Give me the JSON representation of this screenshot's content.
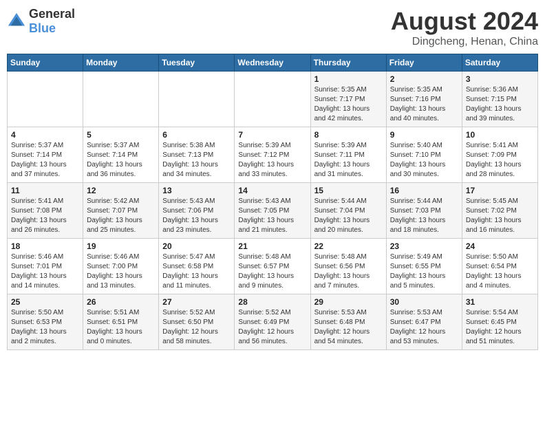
{
  "logo": {
    "text_general": "General",
    "text_blue": "Blue"
  },
  "header": {
    "month_year": "August 2024",
    "location": "Dingcheng, Henan, China"
  },
  "weekdays": [
    "Sunday",
    "Monday",
    "Tuesday",
    "Wednesday",
    "Thursday",
    "Friday",
    "Saturday"
  ],
  "weeks": [
    [
      {
        "day": "",
        "info": ""
      },
      {
        "day": "",
        "info": ""
      },
      {
        "day": "",
        "info": ""
      },
      {
        "day": "",
        "info": ""
      },
      {
        "day": "1",
        "info": "Sunrise: 5:35 AM\nSunset: 7:17 PM\nDaylight: 13 hours\nand 42 minutes."
      },
      {
        "day": "2",
        "info": "Sunrise: 5:35 AM\nSunset: 7:16 PM\nDaylight: 13 hours\nand 40 minutes."
      },
      {
        "day": "3",
        "info": "Sunrise: 5:36 AM\nSunset: 7:15 PM\nDaylight: 13 hours\nand 39 minutes."
      }
    ],
    [
      {
        "day": "4",
        "info": "Sunrise: 5:37 AM\nSunset: 7:14 PM\nDaylight: 13 hours\nand 37 minutes."
      },
      {
        "day": "5",
        "info": "Sunrise: 5:37 AM\nSunset: 7:14 PM\nDaylight: 13 hours\nand 36 minutes."
      },
      {
        "day": "6",
        "info": "Sunrise: 5:38 AM\nSunset: 7:13 PM\nDaylight: 13 hours\nand 34 minutes."
      },
      {
        "day": "7",
        "info": "Sunrise: 5:39 AM\nSunset: 7:12 PM\nDaylight: 13 hours\nand 33 minutes."
      },
      {
        "day": "8",
        "info": "Sunrise: 5:39 AM\nSunset: 7:11 PM\nDaylight: 13 hours\nand 31 minutes."
      },
      {
        "day": "9",
        "info": "Sunrise: 5:40 AM\nSunset: 7:10 PM\nDaylight: 13 hours\nand 30 minutes."
      },
      {
        "day": "10",
        "info": "Sunrise: 5:41 AM\nSunset: 7:09 PM\nDaylight: 13 hours\nand 28 minutes."
      }
    ],
    [
      {
        "day": "11",
        "info": "Sunrise: 5:41 AM\nSunset: 7:08 PM\nDaylight: 13 hours\nand 26 minutes."
      },
      {
        "day": "12",
        "info": "Sunrise: 5:42 AM\nSunset: 7:07 PM\nDaylight: 13 hours\nand 25 minutes."
      },
      {
        "day": "13",
        "info": "Sunrise: 5:43 AM\nSunset: 7:06 PM\nDaylight: 13 hours\nand 23 minutes."
      },
      {
        "day": "14",
        "info": "Sunrise: 5:43 AM\nSunset: 7:05 PM\nDaylight: 13 hours\nand 21 minutes."
      },
      {
        "day": "15",
        "info": "Sunrise: 5:44 AM\nSunset: 7:04 PM\nDaylight: 13 hours\nand 20 minutes."
      },
      {
        "day": "16",
        "info": "Sunrise: 5:44 AM\nSunset: 7:03 PM\nDaylight: 13 hours\nand 18 minutes."
      },
      {
        "day": "17",
        "info": "Sunrise: 5:45 AM\nSunset: 7:02 PM\nDaylight: 13 hours\nand 16 minutes."
      }
    ],
    [
      {
        "day": "18",
        "info": "Sunrise: 5:46 AM\nSunset: 7:01 PM\nDaylight: 13 hours\nand 14 minutes."
      },
      {
        "day": "19",
        "info": "Sunrise: 5:46 AM\nSunset: 7:00 PM\nDaylight: 13 hours\nand 13 minutes."
      },
      {
        "day": "20",
        "info": "Sunrise: 5:47 AM\nSunset: 6:58 PM\nDaylight: 13 hours\nand 11 minutes."
      },
      {
        "day": "21",
        "info": "Sunrise: 5:48 AM\nSunset: 6:57 PM\nDaylight: 13 hours\nand 9 minutes."
      },
      {
        "day": "22",
        "info": "Sunrise: 5:48 AM\nSunset: 6:56 PM\nDaylight: 13 hours\nand 7 minutes."
      },
      {
        "day": "23",
        "info": "Sunrise: 5:49 AM\nSunset: 6:55 PM\nDaylight: 13 hours\nand 5 minutes."
      },
      {
        "day": "24",
        "info": "Sunrise: 5:50 AM\nSunset: 6:54 PM\nDaylight: 13 hours\nand 4 minutes."
      }
    ],
    [
      {
        "day": "25",
        "info": "Sunrise: 5:50 AM\nSunset: 6:53 PM\nDaylight: 13 hours\nand 2 minutes."
      },
      {
        "day": "26",
        "info": "Sunrise: 5:51 AM\nSunset: 6:51 PM\nDaylight: 13 hours\nand 0 minutes."
      },
      {
        "day": "27",
        "info": "Sunrise: 5:52 AM\nSunset: 6:50 PM\nDaylight: 12 hours\nand 58 minutes."
      },
      {
        "day": "28",
        "info": "Sunrise: 5:52 AM\nSunset: 6:49 PM\nDaylight: 12 hours\nand 56 minutes."
      },
      {
        "day": "29",
        "info": "Sunrise: 5:53 AM\nSunset: 6:48 PM\nDaylight: 12 hours\nand 54 minutes."
      },
      {
        "day": "30",
        "info": "Sunrise: 5:53 AM\nSunset: 6:47 PM\nDaylight: 12 hours\nand 53 minutes."
      },
      {
        "day": "31",
        "info": "Sunrise: 5:54 AM\nSunset: 6:45 PM\nDaylight: 12 hours\nand 51 minutes."
      }
    ]
  ]
}
